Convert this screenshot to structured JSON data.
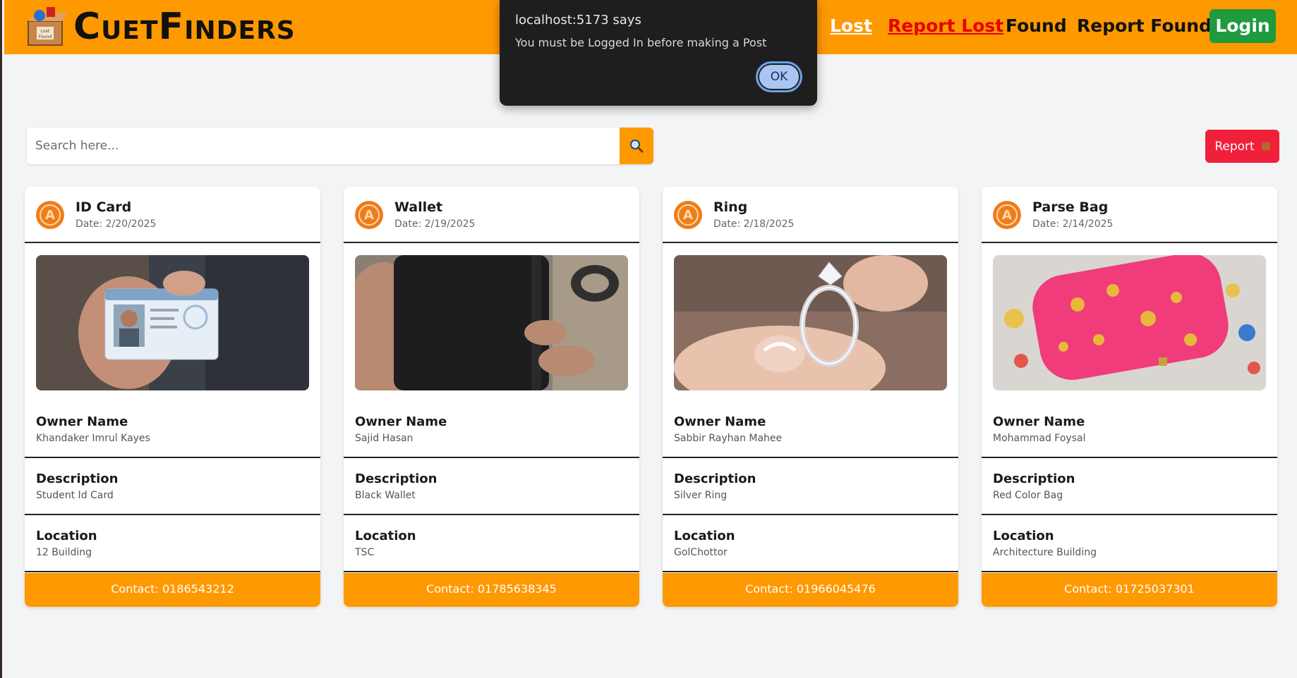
{
  "header": {
    "logo_text": "CuetFinders",
    "nav": {
      "lost": "Lost",
      "report_lost": "Report Lost",
      "found": "Found",
      "report_found": "Report Found"
    },
    "login_label": "Login"
  },
  "dialog": {
    "title": "localhost:5173 says",
    "message": "You must be Logged In before making a Post",
    "ok_label": "OK"
  },
  "search": {
    "placeholder": "Search here...",
    "icon": "search-icon"
  },
  "report_button": {
    "label": "Report",
    "icon": "box-icon"
  },
  "colors": {
    "header_bg": "#ff9900",
    "login_bg": "#1f9a3d",
    "report_bg": "#f0203a",
    "active_nav": "#e60000"
  },
  "labels": {
    "owner": "Owner Name",
    "description": "Description",
    "location": "Location"
  },
  "cards": [
    {
      "title": "ID Card",
      "date": "Date: 2/20/2025",
      "owner": "Khandaker Imrul Kayes",
      "description": "Student Id Card",
      "location": "12 Building",
      "contact": "Contact: 0186543212"
    },
    {
      "title": "Wallet",
      "date": "Date: 2/19/2025",
      "owner": "Sajid Hasan",
      "description": "Black Wallet",
      "location": "TSC",
      "contact": "Contact: 01785638345"
    },
    {
      "title": "Ring",
      "date": "Date: 2/18/2025",
      "owner": "Sabbir Rayhan Mahee",
      "description": "Silver Ring",
      "location": "GolChottor",
      "contact": "Contact: 01966045476"
    },
    {
      "title": "Parse Bag",
      "date": "Date: 2/14/2025",
      "owner": "Mohammad Foysal",
      "description": "Red Color Bag",
      "location": "Architecture Building",
      "contact": "Contact: 01725037301"
    }
  ]
}
